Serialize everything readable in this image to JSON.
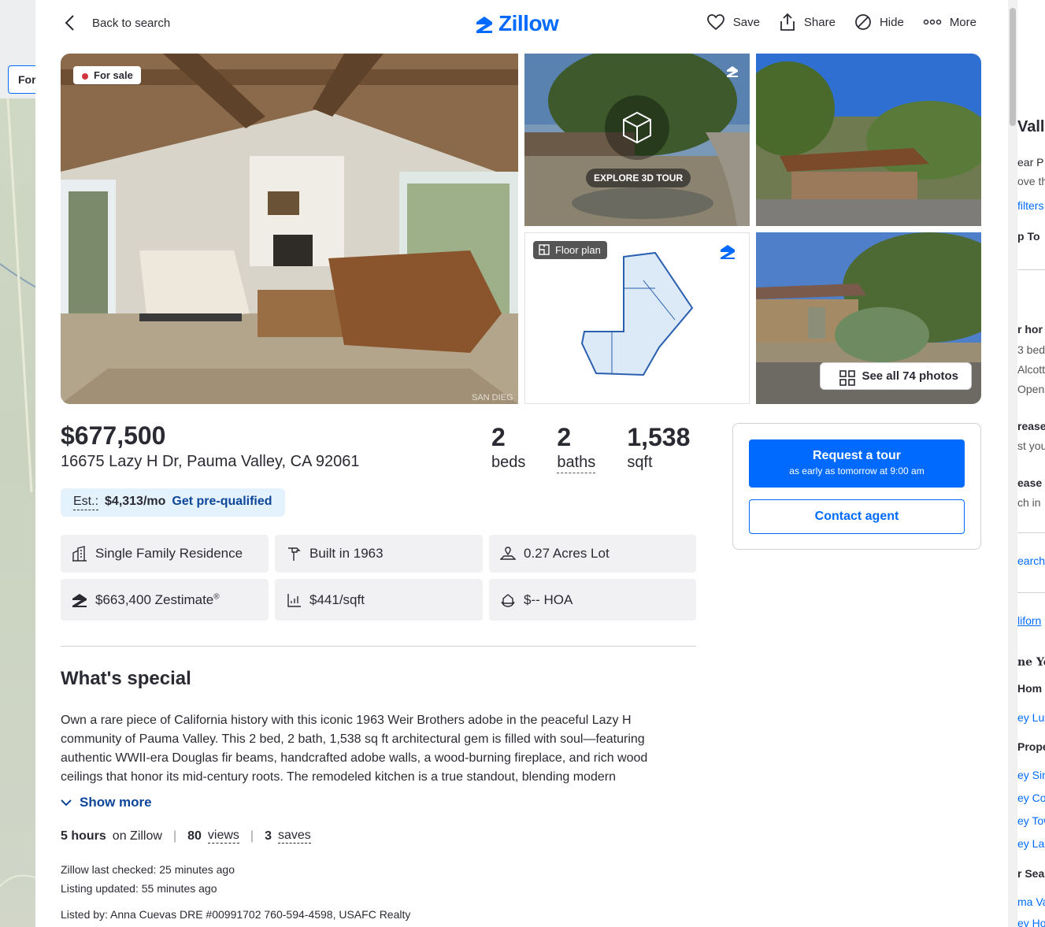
{
  "nav": {
    "back_label": "Back to search",
    "logo_text": "Zillow",
    "actions": {
      "save": "Save",
      "share": "Share",
      "hide": "Hide",
      "more": "More"
    }
  },
  "gallery": {
    "status_badge": "For sale",
    "tour_label": "EXPLORE 3D TOUR",
    "floor_plan_label": "Floor plan",
    "see_all_label": "See all 74 photos",
    "watermark": "SAN DIEG"
  },
  "summary": {
    "price": "$677,500",
    "address": "16675 Lazy H Dr, Pauma Valley, CA 92061",
    "beds": {
      "value": "2",
      "label": "beds"
    },
    "baths": {
      "value": "2",
      "label": "baths"
    },
    "sqft": {
      "value": "1,538",
      "label": "sqft"
    },
    "est_label": "Est.:",
    "est_value": "$4,313/mo",
    "prequal_link": "Get pre-qualified"
  },
  "facts": [
    {
      "icon": "building-icon",
      "text": "Single Family Residence"
    },
    {
      "icon": "hammer-icon",
      "text": "Built in 1963"
    },
    {
      "icon": "lot-icon",
      "text": "0.27 Acres Lot"
    },
    {
      "icon": "zestimate-icon",
      "text": "$663,400 Zestimate",
      "sup": "®"
    },
    {
      "icon": "price-per-sqft-icon",
      "text": "$441/sqft"
    },
    {
      "icon": "hoa-icon",
      "text": "$-- HOA"
    }
  ],
  "special": {
    "title": "What's special",
    "description": "Own a rare piece of California history with this iconic 1963 Weir Brothers adobe in the peaceful Lazy H community of Pauma Valley. This 2 bed, 2 bath, 1,538 sq ft architectural gem is filled with soul—featuring authentic WWII-era Douglas fir beams, handcrafted adobe walls, a wood-burning fireplace, and rich wood ceilings that honor its mid-century roots.  The remodeled kitchen is a true standout, blending modern",
    "show_more": "Show more"
  },
  "engagement": {
    "time_value": "5 hours",
    "time_label": "on Zillow",
    "views_value": "80",
    "views_label": "views",
    "saves_value": "3",
    "saves_label": "saves"
  },
  "listing_meta": {
    "last_checked": "Zillow last checked: 25 minutes ago",
    "updated": "Listing updated: 55 minutes ago",
    "listed_by": "Listed by: Anna Cuevas DRE #00991702 760-594-4598, USAFC Realty"
  },
  "contact": {
    "tour_button": "Request a tour",
    "tour_subtext": "as early as tomorrow at 9:00 am",
    "agent_button": "Contact agent"
  },
  "background": {
    "filter_button": "For",
    "right_texts": [
      "Vall",
      "ear P",
      "ove th",
      "filters",
      "p To",
      "r hor",
      "3 bed",
      "Alcott",
      "Open",
      "rease",
      "st you",
      "ease",
      "ch in",
      "earch",
      "liforn",
      "ne You",
      "Hom",
      "ey Lux",
      "Prope",
      "ey Sin",
      "ey Cor",
      "ey Tow",
      "ey Lan",
      "r Sea",
      "ma Va",
      "ey Hon"
    ]
  },
  "colors": {
    "brand_blue": "#006aff",
    "link_blue": "#0d4599",
    "sale_red": "#d1363e",
    "est_bg": "#e3f2fd",
    "fact_bg": "#f1f1f4"
  }
}
